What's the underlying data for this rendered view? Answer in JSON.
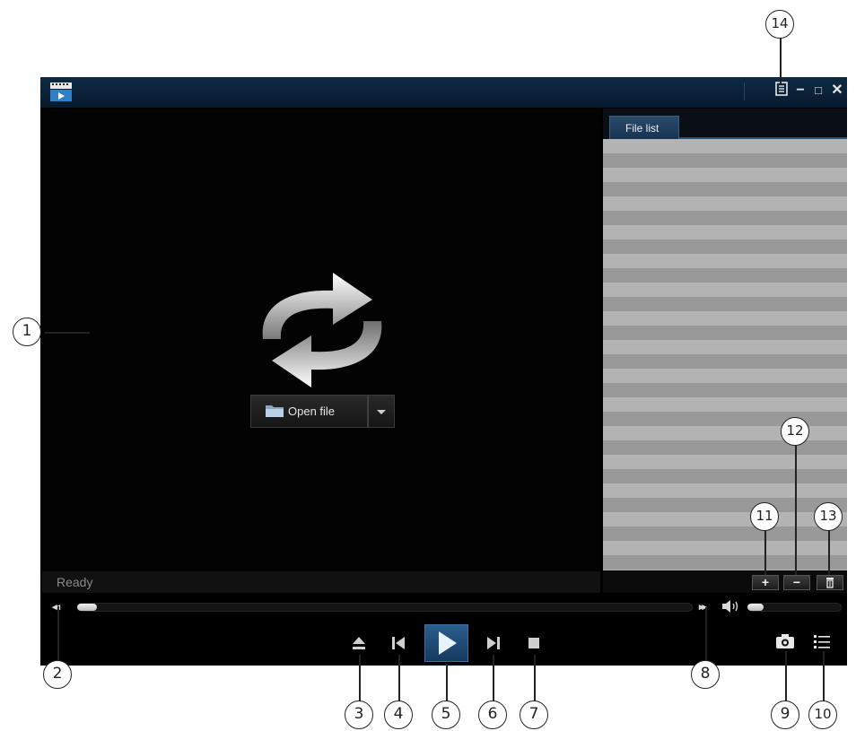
{
  "window": {
    "minimize_glyph": "−",
    "maximize_glyph": "□",
    "close_glyph": "✕"
  },
  "player": {
    "open_file_label": "Open file",
    "status": "Ready",
    "seek_progress": 0.0,
    "volume_level": 0.0
  },
  "file_panel": {
    "tab_label": "File list",
    "add_label": "+",
    "remove_label": "−"
  },
  "transport": {
    "rewind_glyph": "◂◂",
    "forward_glyph": "▸▸"
  },
  "callouts": [
    "1",
    "2",
    "3",
    "4",
    "5",
    "6",
    "7",
    "8",
    "9",
    "10",
    "11",
    "12",
    "13",
    "14"
  ],
  "colors": {
    "titlebar": "#0e2a44",
    "accent_play": "#2b5e8e",
    "list_row_light": "#b3b3b3",
    "list_row_dark": "#999999"
  },
  "icons": [
    "app-logo-icon",
    "playlist-menu-icon",
    "eject-icon",
    "previous-icon",
    "play-icon",
    "next-icon",
    "stop-icon",
    "snapshot-camera-icon",
    "list-icon",
    "volume-icon",
    "folder-icon",
    "trash-icon",
    "replay-arrows-icon"
  ]
}
